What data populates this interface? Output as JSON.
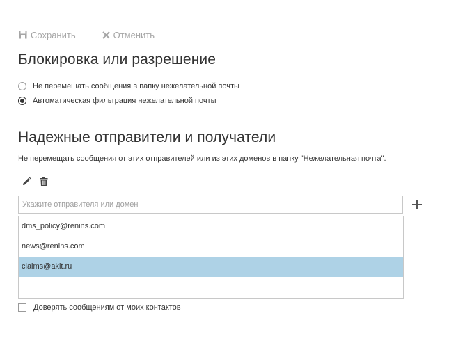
{
  "toolbar": {
    "save_label": "Сохранить",
    "cancel_label": "Отменить"
  },
  "block_section": {
    "title": "Блокировка или разрешение",
    "options": [
      {
        "label": "Не перемещать сообщения в папку нежелательной почты",
        "checked": false
      },
      {
        "label": "Автоматическая фильтрация нежелательной почты",
        "checked": true
      }
    ]
  },
  "safe_section": {
    "title": "Надежные отправители и получатели",
    "description": "Не перемещать сообщения от этих отправителей или из этих доменов в папку \"Нежелательная почта\".",
    "input_placeholder": "Укажите отправителя или домен",
    "items": [
      {
        "label": "dms_policy@renins.com",
        "selected": false
      },
      {
        "label": "news@renins.com",
        "selected": false
      },
      {
        "label": "claims@akit.ru",
        "selected": true
      }
    ],
    "trust_contacts_label": "Доверять сообщениям от моих контактов",
    "trust_contacts_checked": false
  },
  "icons": [
    "save-icon",
    "cancel-icon",
    "edit-icon",
    "delete-icon",
    "add-icon"
  ],
  "colors": {
    "selected_row": "#aed2e6",
    "toolbar_disabled": "#a6a6a6",
    "text": "#333333"
  }
}
